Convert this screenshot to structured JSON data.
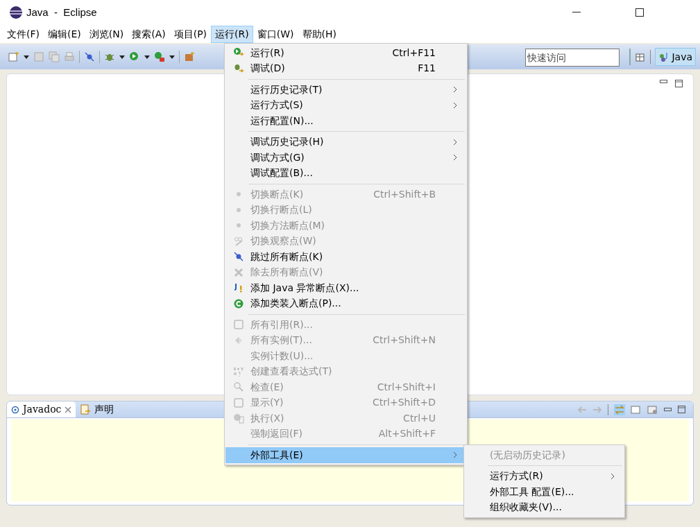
{
  "window": {
    "title": "Java  -  Eclipse"
  },
  "menu_bar": [
    {
      "label": "文件(F)",
      "selected": false
    },
    {
      "label": "编辑(E)",
      "selected": false
    },
    {
      "label": "浏览(N)",
      "selected": false
    },
    {
      "label": "搜索(A)",
      "selected": false
    },
    {
      "label": "项目(P)",
      "selected": false
    },
    {
      "label": "运行(R)",
      "selected": true
    },
    {
      "label": "窗口(W)",
      "selected": false
    },
    {
      "label": "帮助(H)",
      "selected": false
    }
  ],
  "toolbar": {
    "quick_access": {
      "placeholder": "快速访问"
    },
    "perspective": {
      "label": "Java",
      "selected": true
    }
  },
  "bottom_panel": {
    "tabs": [
      {
        "label": "Javadoc",
        "selected": true,
        "closable": true
      },
      {
        "label": "声明",
        "selected": false,
        "closable": false
      }
    ]
  },
  "run_menu": [
    {
      "kind": "item",
      "label": "运行(R)",
      "shortcut": "Ctrl+F11",
      "disabled": false,
      "submenu": false,
      "selected": false
    },
    {
      "kind": "item",
      "label": "调试(D)",
      "shortcut": "F11",
      "disabled": false,
      "submenu": false,
      "selected": false
    },
    {
      "kind": "separator"
    },
    {
      "kind": "item",
      "label": "运行历史记录(T)",
      "disabled": false,
      "submenu": true,
      "selected": false
    },
    {
      "kind": "item",
      "label": "运行方式(S)",
      "disabled": false,
      "submenu": true,
      "selected": false
    },
    {
      "kind": "item",
      "label": "运行配置(N)...",
      "disabled": false,
      "submenu": false,
      "selected": false
    },
    {
      "kind": "separator"
    },
    {
      "kind": "item",
      "label": "调试历史记录(H)",
      "disabled": false,
      "submenu": true,
      "selected": false
    },
    {
      "kind": "item",
      "label": "调试方式(G)",
      "disabled": false,
      "submenu": true,
      "selected": false
    },
    {
      "kind": "item",
      "label": "调试配置(B)...",
      "disabled": false,
      "submenu": false,
      "selected": false
    },
    {
      "kind": "separator"
    },
    {
      "kind": "item",
      "label": "切换断点(K)",
      "shortcut": "Ctrl+Shift+B",
      "disabled": true,
      "submenu": false,
      "selected": false
    },
    {
      "kind": "item",
      "label": "切换行断点(L)",
      "disabled": true,
      "submenu": false,
      "selected": false
    },
    {
      "kind": "item",
      "label": "切换方法断点(M)",
      "disabled": true,
      "submenu": false,
      "selected": false
    },
    {
      "kind": "item",
      "label": "切换观察点(W)",
      "disabled": true,
      "submenu": false,
      "selected": false
    },
    {
      "kind": "item",
      "label": "跳过所有断点(K)",
      "disabled": false,
      "submenu": false,
      "selected": false
    },
    {
      "kind": "item",
      "label": "除去所有断点(V)",
      "disabled": true,
      "submenu": false,
      "selected": false
    },
    {
      "kind": "item",
      "label": "添加 Java 异常断点(X)...",
      "disabled": false,
      "submenu": false,
      "selected": false
    },
    {
      "kind": "item",
      "label": "添加类装入断点(P)...",
      "disabled": false,
      "submenu": false,
      "selected": false
    },
    {
      "kind": "separator"
    },
    {
      "kind": "item",
      "label": "所有引用(R)...",
      "disabled": true,
      "submenu": false,
      "selected": false
    },
    {
      "kind": "item",
      "label": "所有实例(T)...",
      "shortcut": "Ctrl+Shift+N",
      "disabled": true,
      "submenu": false,
      "selected": false
    },
    {
      "kind": "item",
      "label": "实例计数(U)...",
      "disabled": true,
      "submenu": false,
      "selected": false
    },
    {
      "kind": "item",
      "label": "创建查看表达式(T)",
      "disabled": true,
      "submenu": false,
      "selected": false
    },
    {
      "kind": "item",
      "label": "检查(E)",
      "shortcut": "Ctrl+Shift+I",
      "disabled": true,
      "submenu": false,
      "selected": false
    },
    {
      "kind": "item",
      "label": "显示(Y)",
      "shortcut": "Ctrl+Shift+D",
      "disabled": true,
      "submenu": false,
      "selected": false
    },
    {
      "kind": "item",
      "label": "执行(X)",
      "shortcut": "Ctrl+U",
      "disabled": true,
      "submenu": false,
      "selected": false
    },
    {
      "kind": "item",
      "label": "强制返回(F)",
      "shortcut": "Alt+Shift+F",
      "disabled": true,
      "submenu": false,
      "selected": false
    },
    {
      "kind": "separator"
    },
    {
      "kind": "item",
      "label": "外部工具(E)",
      "disabled": false,
      "submenu": true,
      "selected": true
    }
  ],
  "external_tools_submenu": [
    {
      "kind": "item",
      "label": "(无启动历史记录)",
      "disabled": true,
      "submenu": false,
      "selected": false
    },
    {
      "kind": "separator"
    },
    {
      "kind": "item",
      "label": "运行方式(R)",
      "disabled": false,
      "submenu": true,
      "selected": false
    },
    {
      "kind": "item",
      "label": "外部工具 配置(E)...",
      "disabled": false,
      "submenu": false,
      "selected": false
    },
    {
      "kind": "item",
      "label": "组织收藏夹(V)...",
      "disabled": false,
      "submenu": false,
      "selected": false
    }
  ]
}
